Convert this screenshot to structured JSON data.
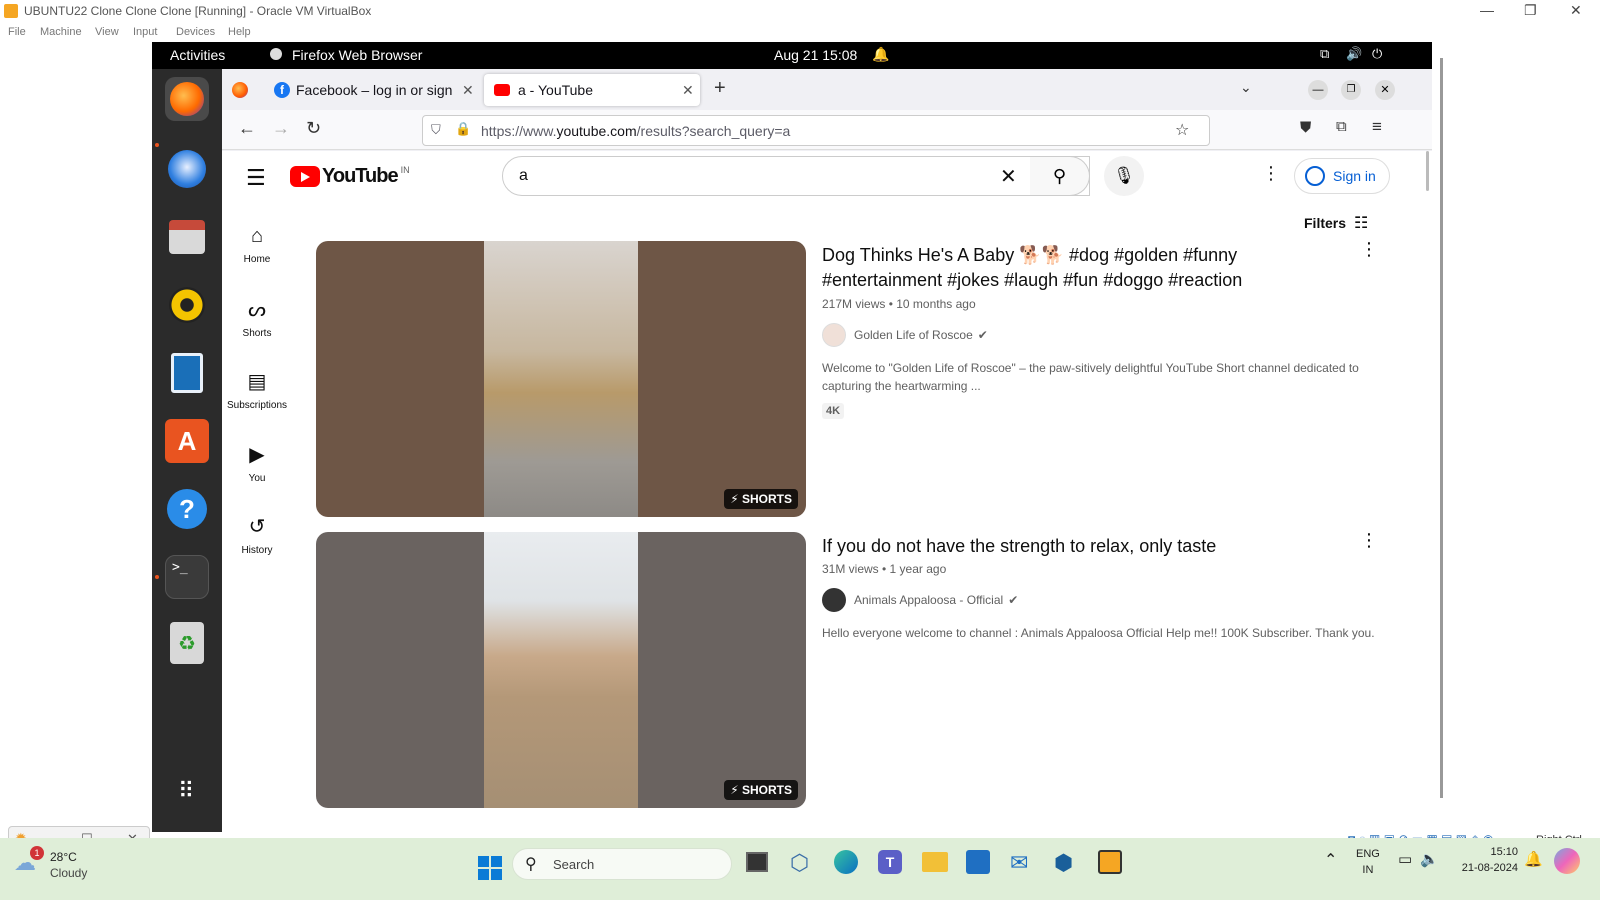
{
  "host": {
    "window_title": "UBUNTU22 Clone Clone Clone [Running] - Oracle VM VirtualBox",
    "menu": [
      "File",
      "Machine",
      "View",
      "Input",
      "Devices",
      "Help"
    ],
    "status_right": "Right Ctrl"
  },
  "ubuntu": {
    "activities": "Activities",
    "app_name": "Firefox Web Browser",
    "clock": "Aug 21  15:08"
  },
  "firefox": {
    "tabs": [
      {
        "label": "Facebook – log in or sign"
      },
      {
        "label": "a - YouTube"
      }
    ],
    "url_prefix": "https://www.",
    "url_domain": "youtube.com",
    "url_rest": "/results?search_query=a"
  },
  "youtube": {
    "country": "IN",
    "logo_text": "YouTube",
    "search_value": "a",
    "sign_in": "Sign in",
    "filters": "Filters",
    "sidebar": [
      {
        "label": "Home"
      },
      {
        "label": "Shorts"
      },
      {
        "label": "Subscriptions"
      },
      {
        "label": "You"
      },
      {
        "label": "History"
      }
    ],
    "results": [
      {
        "title": "Dog Thinks He's A Baby 🐕🐕 #dog #golden #funny #entertainment #jokes #laugh #fun #doggo #reaction",
        "meta": "217M views • 10 months ago",
        "channel": "Golden Life of Roscoe",
        "description": "Welcome to \"Golden Life of Roscoe\" – the paw-sitively delightful YouTube Short channel dedicated to capturing the heartwarming ...",
        "badge": "4K",
        "shorts": "SHORTS"
      },
      {
        "title": "If you do not have the strength to relax, only taste",
        "meta": "31M views • 1 year ago",
        "channel": "Animals Appaloosa - Official",
        "description": "Hello everyone welcome to channel : Animals Appaloosa Official Help me!! 100K Subscriber. Thank you.",
        "badge": "",
        "shorts": "SHORTS"
      }
    ]
  },
  "windows": {
    "weather_temp": "28°C",
    "weather_desc": "Cloudy",
    "weather_badge": "1",
    "search_placeholder": "Search",
    "lang_top": "ENG",
    "lang_bottom": "IN",
    "time": "15:10",
    "date": "21-08-2024"
  }
}
